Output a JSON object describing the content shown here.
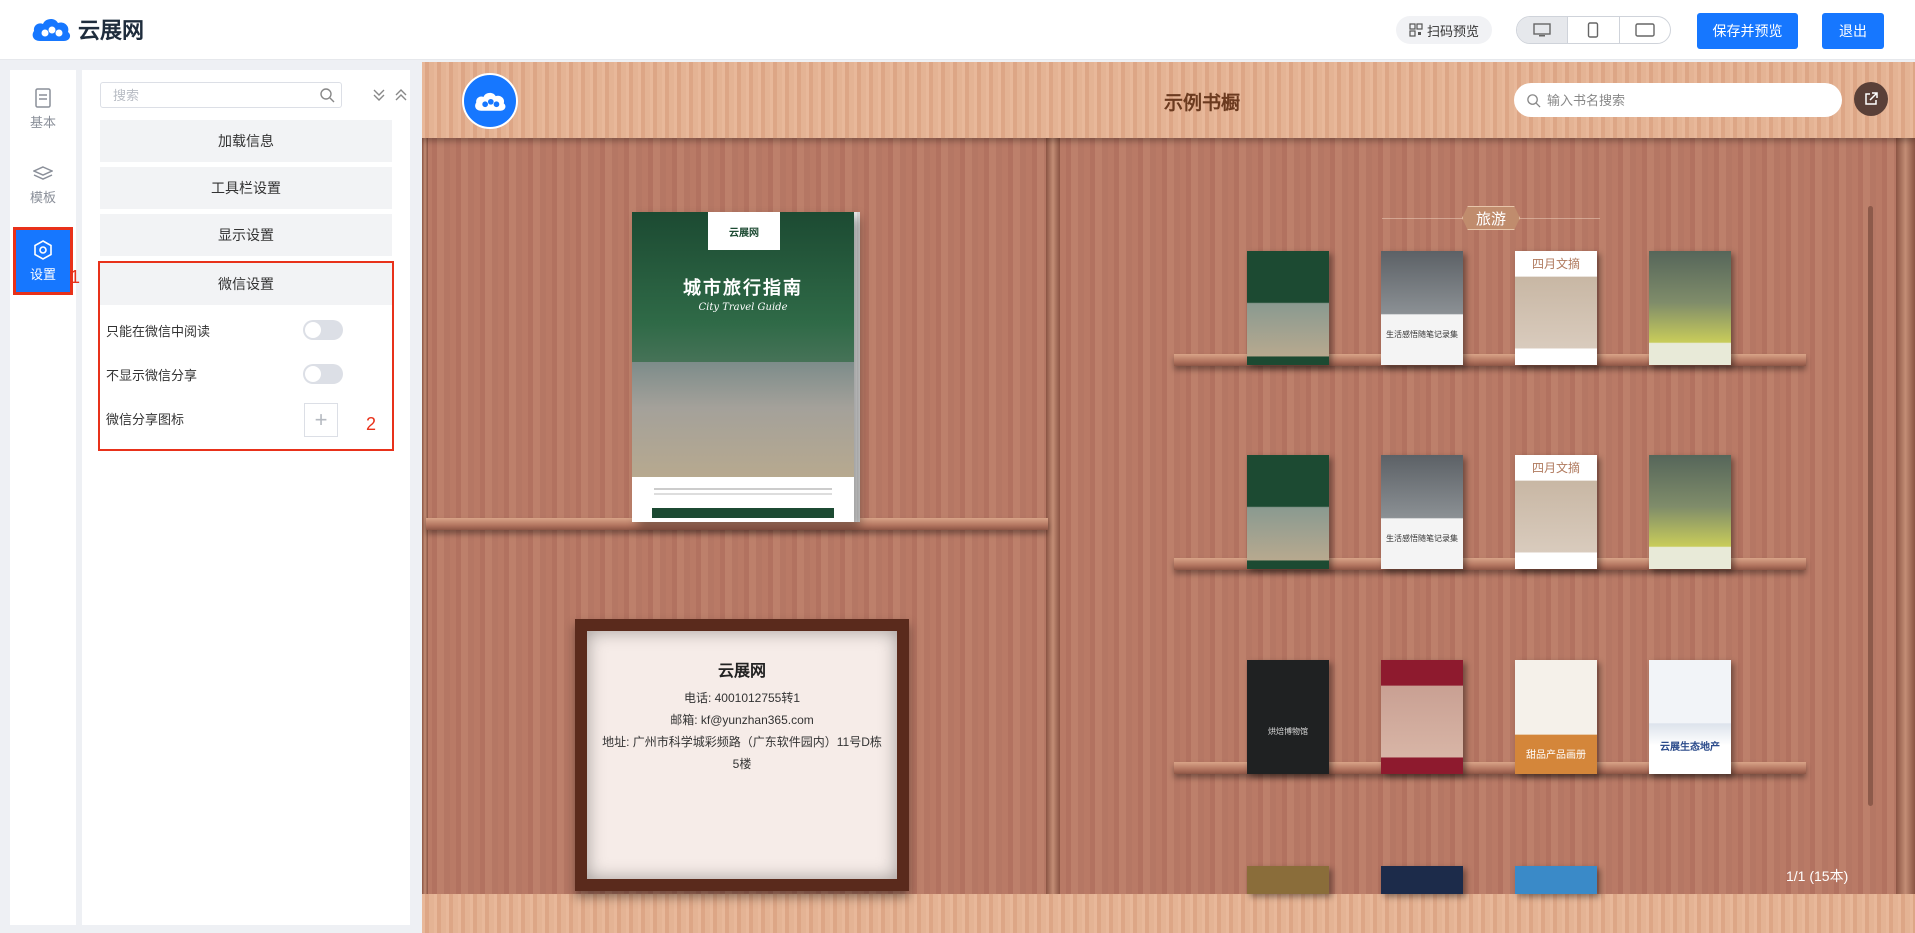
{
  "header": {
    "logo_text": "云展网",
    "scan_preview": "扫码预览",
    "save_preview": "保存并预览",
    "exit": "退出"
  },
  "rail": {
    "items": [
      {
        "label": "基本",
        "icon": "document-icon"
      },
      {
        "label": "模板",
        "icon": "layers-icon"
      },
      {
        "label": "设置",
        "icon": "gear-icon",
        "active": true
      }
    ],
    "annotation_1": "1"
  },
  "panel": {
    "search_placeholder": "搜索",
    "sections": [
      "加载信息",
      "工具栏设置",
      "显示设置",
      "微信设置"
    ],
    "wechat": {
      "only_in_wechat": "只能在微信中阅读",
      "hide_share": "不显示微信分享",
      "share_icon": "微信分享图标",
      "only_in_wechat_on": false,
      "hide_share_on": false
    },
    "annotation_2": "2"
  },
  "shelf": {
    "title": "示例书橱",
    "search_placeholder": "输入书名搜索",
    "featured": {
      "logo": "云展网",
      "title": "城市旅行指南",
      "subtitle": "City Travel Guide"
    },
    "contact": {
      "name": "云展网",
      "phone": "电话: 4001012755转1",
      "email": "邮箱: kf@yunzhan365.com",
      "address": "地址: 广州市科学城彩频路（广东软件园内）11号D栋5楼"
    },
    "category": "旅游",
    "book_labels": {
      "b2": "生活感悟随笔记录集",
      "b3": "四月文摘",
      "b9": "烘焙博物馆",
      "b11": "甜品产品画册",
      "b12": "云展生态地产"
    },
    "page_info": "1/1 (15本)"
  },
  "colors": {
    "accent": "#1677ff",
    "annotation": "#e8311a"
  }
}
